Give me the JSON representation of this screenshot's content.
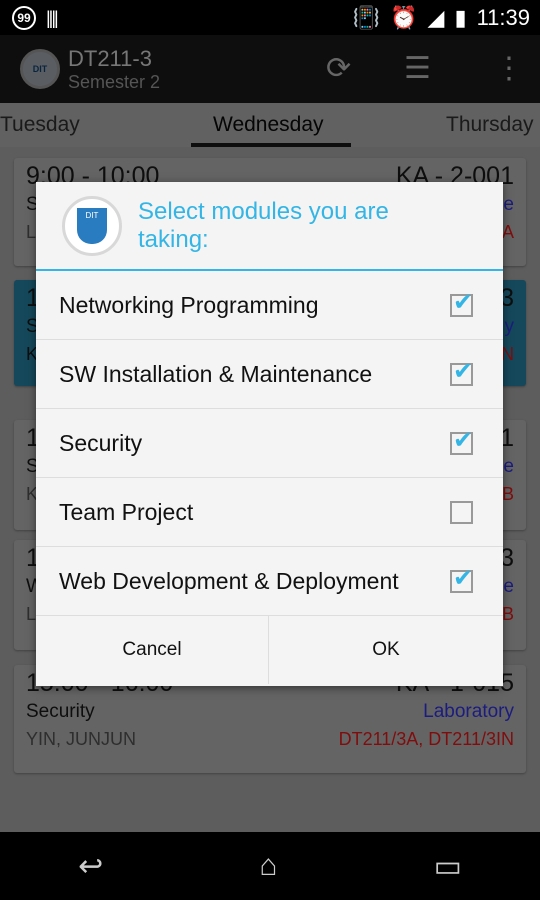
{
  "status_bar": {
    "notification_badge": "99",
    "time": "11:39"
  },
  "action_bar": {
    "title": "DT211-3",
    "subtitle": "Semester 2",
    "logo_text": "DIT",
    "icons": [
      "refresh-icon",
      "settings-sliders-icon",
      "overflow-menu-icon"
    ]
  },
  "tabs": [
    {
      "label": "Tuesday"
    },
    {
      "label": "Wednesday",
      "selected": true
    },
    {
      "label": "Thursday"
    }
  ],
  "cards": [
    {
      "time": "9:00 - 10:00",
      "room": "KA - 2-001",
      "partial_left": [
        "S",
        "L"
      ],
      "partial_right": [
        "e",
        "A"
      ]
    },
    {
      "partial_left": [
        "1",
        "S",
        "K"
      ],
      "partial_right": [
        "3",
        "y",
        "N"
      ]
    },
    {
      "partial_left": [
        "1",
        "S",
        "K"
      ],
      "partial_right": [
        "1",
        "e",
        "B"
      ]
    },
    {
      "partial_left": [
        "1",
        "W",
        "L"
      ],
      "partial_right": [
        "3",
        "e",
        "B"
      ]
    },
    {
      "time": "15:00 - 16:00",
      "room": "KA - 1-015",
      "module": "Security",
      "type": "Laboratory",
      "lecturer": "YIN, JUNJUN",
      "groups": "DT211/3A, DT211/3IN"
    }
  ],
  "dialog": {
    "title": "Select modules you are taking:",
    "logo_text": "DIT",
    "items": [
      {
        "label": "Networking Programming",
        "checked": true
      },
      {
        "label": "SW Installation & Maintenance",
        "checked": true
      },
      {
        "label": "Security",
        "checked": true
      },
      {
        "label": "Team Project",
        "checked": false
      },
      {
        "label": "Web Development & Deployment",
        "checked": true
      }
    ],
    "cancel_label": "Cancel",
    "ok_label": "OK"
  },
  "colors": {
    "accent": "#33b5e5",
    "type": "#3030c0",
    "groups": "#c02020"
  }
}
